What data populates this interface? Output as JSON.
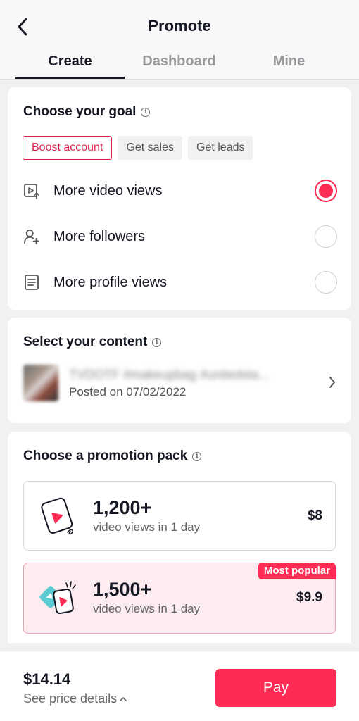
{
  "header": {
    "title": "Promote",
    "back_icon": "back-arrow-icon",
    "tabs": [
      {
        "label": "Create",
        "active": true
      },
      {
        "label": "Dashboard",
        "active": false
      },
      {
        "label": "Mine",
        "active": false
      }
    ]
  },
  "goal": {
    "title": "Choose your goal",
    "chips": [
      {
        "label": "Boost account",
        "selected": true
      },
      {
        "label": "Get sales",
        "selected": false
      },
      {
        "label": "Get leads",
        "selected": false
      }
    ],
    "options": [
      {
        "label": "More video views",
        "icon": "video-play-icon",
        "selected": true
      },
      {
        "label": "More followers",
        "icon": "add-user-icon",
        "selected": false
      },
      {
        "label": "More profile views",
        "icon": "profile-document-icon",
        "selected": false
      }
    ]
  },
  "content": {
    "title": "Select your content",
    "caption": "TVDOTF #makeupbag #unitedsta...",
    "date": "Posted on 07/02/2022"
  },
  "pack": {
    "title": "Choose a promotion pack",
    "packs": [
      {
        "count": "1,200+",
        "subtitle": "video views in 1 day",
        "price": "$8",
        "badge": ""
      },
      {
        "count": "1,500+",
        "subtitle": "video views in 1 day",
        "price": "$9.9",
        "badge": "Most popular"
      }
    ]
  },
  "footer": {
    "total": "$14.14",
    "details_label": "See price details",
    "pay_label": "Pay"
  },
  "colors": {
    "accent": "#fe2c55",
    "chip_selected": "#e0204c",
    "popular_bg": "#fcecef",
    "teal": "#5ccbd3"
  }
}
